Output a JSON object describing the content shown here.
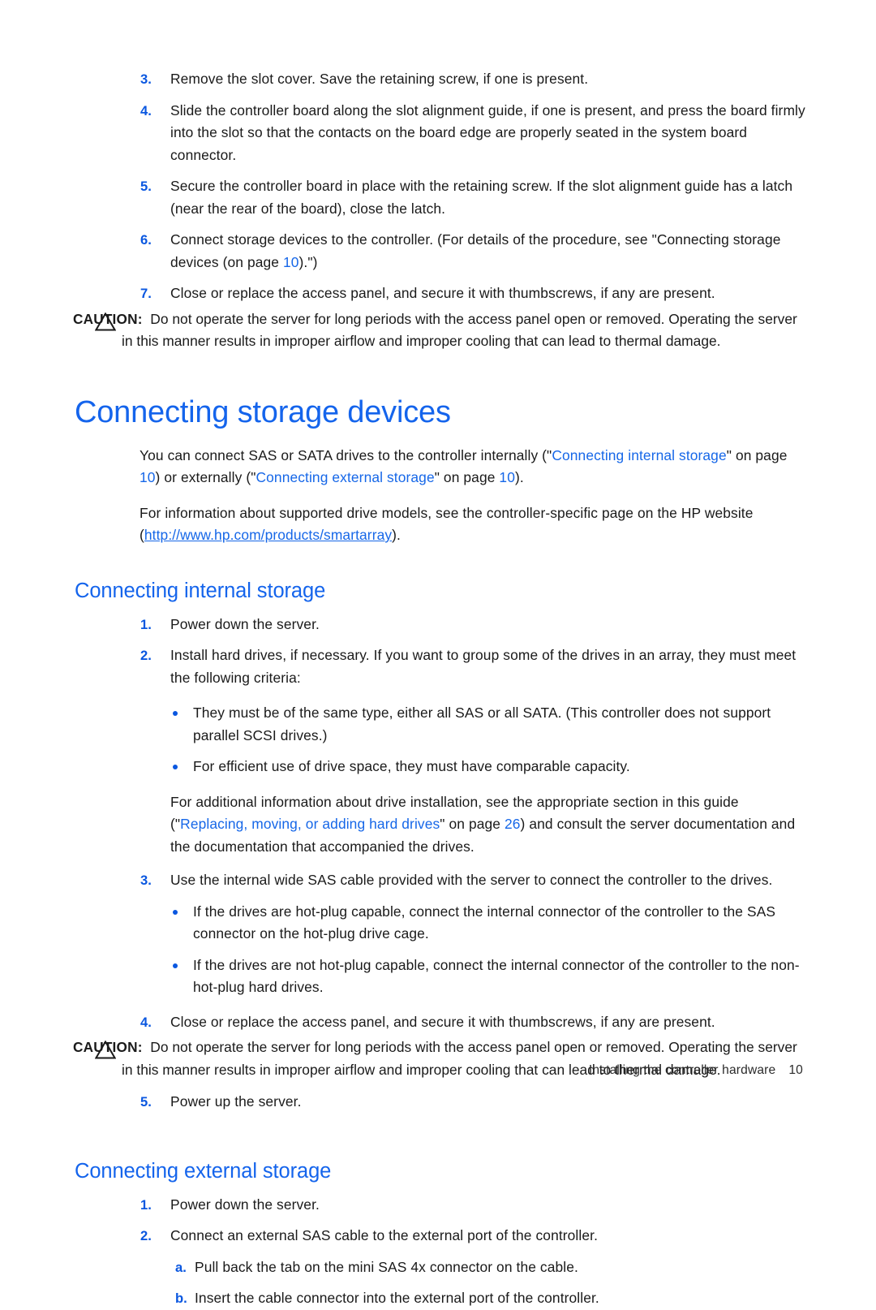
{
  "document": {
    "title": "Connecting storage devices",
    "accent_blue": "#1464ec",
    "marker_blue": "#0a57e0",
    "link_blue": "#1667e8",
    "body_color": "#1a1a1a"
  },
  "steps_top": [
    {
      "marker": "3.",
      "text": "Remove the slot cover. Save the retaining screw, if one is present."
    },
    {
      "marker": "4.",
      "text": "Slide the controller board along the slot alignment guide, if one is present, and press the board firmly into the slot so that the contacts on the board edge are properly seated in the system board connector."
    },
    {
      "marker": "5.",
      "text": "Secure the controller board in place with the retaining screw. If the slot alignment guide has a latch (near the rear of the board), close the latch."
    },
    {
      "marker": "6.",
      "text_before": "Connect storage devices to the controller. (For details of the procedure, see \"Connecting storage devices (on page ",
      "page_link": "10",
      "text_after": ").\")"
    },
    {
      "marker": "7.",
      "text": "Close or replace the access panel, and secure it with thumbscrews, if any are present."
    }
  ],
  "caution_1": {
    "icon": "warning-triangle-icon",
    "label": "CAUTION:",
    "text": "Do not operate the server for long periods with the access panel open or removed. Operating the server in this manner results in improper airflow and improper cooling that can lead to thermal damage."
  },
  "heading_main": "Connecting storage devices",
  "intro": {
    "p1_a": "You can connect SAS or SATA drives to the controller internally (\"",
    "p1_link1": "Connecting internal storage",
    "p1_b": "\" on page ",
    "p1_page1": "10",
    "p1_c": ") or externally (\"",
    "p1_link2": "Connecting external storage",
    "p1_d": "\" on page ",
    "p1_page2": "10",
    "p1_e": ").",
    "p2_a": "For information about supported drive models, see the controller-specific page on the HP website (",
    "p2_url": "http://www.hp.com/products/smartarray",
    "p2_b": ")."
  },
  "heading_internal": "Connecting internal storage",
  "internal_steps": [
    {
      "marker": "1.",
      "text": "Power down the server."
    },
    {
      "marker": "2.",
      "text": "Install hard drives, if necessary. If you want to group some of the drives in an array, they must meet the following criteria:"
    }
  ],
  "internal_bullets_1": [
    "They must be of the same type, either all SAS or all SATA. (This controller does not support parallel SCSI drives.)",
    "For efficient use of drive space, they must have comparable capacity."
  ],
  "internal_note": {
    "a": "For additional information about drive installation, see the appropriate section in this guide (\"",
    "link": "Replacing, moving, or adding hard drives",
    "b": "\" on page ",
    "page": "26",
    "c": ") and consult the server documentation and the documentation that accompanied the drives."
  },
  "internal_step_3": {
    "marker": "3.",
    "text": "Use the internal wide SAS cable provided with the server to connect the controller to the drives."
  },
  "internal_bullets_2": [
    "If the drives are hot-plug capable, connect the internal connector of the controller to the SAS connector on the hot-plug drive cage.",
    "If the drives are not hot-plug capable, connect the internal connector of the controller to the non-hot-plug hard drives."
  ],
  "internal_step_4": {
    "marker": "4.",
    "text": "Close or replace the access panel, and secure it with thumbscrews, if any are present."
  },
  "caution_2": {
    "icon": "warning-triangle-icon",
    "label": "CAUTION:",
    "text": "Do not operate the server for long periods with the access panel open or removed. Operating the server in this manner results in improper airflow and improper cooling that can lead to thermal damage."
  },
  "internal_step_5": {
    "marker": "5.",
    "text": "Power up the server."
  },
  "heading_external": "Connecting external storage",
  "external_steps": [
    {
      "marker": "1.",
      "text": "Power down the server."
    },
    {
      "marker": "2.",
      "text": "Connect an external SAS cable to the external port of the controller."
    }
  ],
  "external_substeps": [
    {
      "marker": "a.",
      "text": "Pull back the tab on the mini SAS 4x connector on the cable."
    },
    {
      "marker": "b.",
      "text": "Insert the cable connector into the external port of the controller."
    }
  ],
  "footer": {
    "title": "Installing the controller hardware",
    "page": "10"
  }
}
